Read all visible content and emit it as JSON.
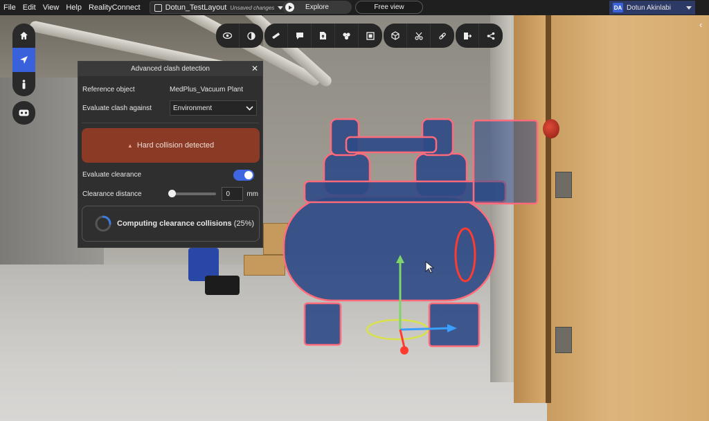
{
  "menu": {
    "items": [
      "File",
      "Edit",
      "View",
      "Help",
      "RealityConnect"
    ]
  },
  "file": {
    "name": "Dotun_TestLayout",
    "status": "Unsaved changes"
  },
  "modes": {
    "explore": "Explore",
    "free": "Free view"
  },
  "user": {
    "initials": "DA",
    "name": "Dotun Akinlabi"
  },
  "dialog": {
    "title": "Advanced clash detection",
    "reference_label": "Reference object",
    "reference_value": "MedPlus_Vacuum Plant",
    "against_label": "Evaluate clash against",
    "against_value": "Environment",
    "alert": "Hard collision detected",
    "clearance_label": "Evaluate clearance",
    "clearance_enabled": true,
    "distance_label": "Clearance distance",
    "distance_value": "0",
    "distance_unit": "mm",
    "progress_label": "Computing clearance collisions",
    "progress_percent": "(25%)",
    "progress_fraction": 0.25
  },
  "colors": {
    "accent": "#3d66e0",
    "alert": "#8a3a25",
    "clash_outline": "#ff6b7a",
    "model": "#2e4a86"
  },
  "toolbar_icons": [
    "eye-icon",
    "contrast-icon",
    "measure-icon",
    "comment-icon",
    "document-upload-icon",
    "layers-icon",
    "frame-icon",
    "cube-icon",
    "scissors-icon",
    "link-icon",
    "export-icon",
    "share-icon"
  ],
  "nav_icons": [
    "home-icon",
    "navigate-icon",
    "person-icon",
    "vr-headset-icon"
  ]
}
